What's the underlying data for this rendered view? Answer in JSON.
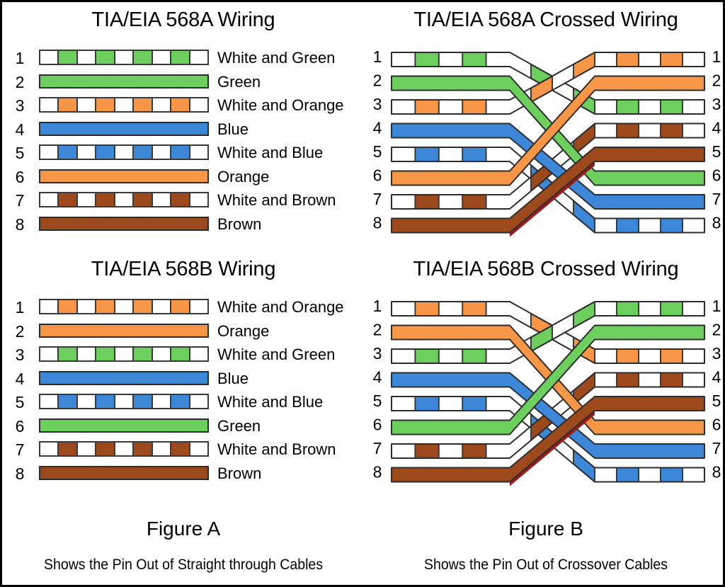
{
  "colors": {
    "green": "#6CCF5E",
    "orange": "#F79646",
    "blue": "#3D87D8",
    "brown": "#9C4A1C",
    "white": "#FFFFFF",
    "dark_red": "#9E1B1B",
    "outline": "#3A3A3A",
    "text": "#000000",
    "background": "#FFFFFF"
  },
  "panels": {
    "a_top": {
      "title": "TIA/EIA 568A Wiring",
      "pins": [
        {
          "num": "1",
          "label": "White and Green",
          "color": "green",
          "striped": true
        },
        {
          "num": "2",
          "label": "Green",
          "color": "green",
          "striped": false
        },
        {
          "num": "3",
          "label": "White and Orange",
          "color": "orange",
          "striped": true
        },
        {
          "num": "4",
          "label": "Blue",
          "color": "blue",
          "striped": false
        },
        {
          "num": "5",
          "label": "White and Blue",
          "color": "blue",
          "striped": true
        },
        {
          "num": "6",
          "label": "Orange",
          "color": "orange",
          "striped": false
        },
        {
          "num": "7",
          "label": "White and Brown",
          "color": "brown",
          "striped": true
        },
        {
          "num": "8",
          "label": "Brown",
          "color": "brown",
          "striped": false
        }
      ]
    },
    "b_bottom": {
      "title": "TIA/EIA 568B Wiring",
      "pins": [
        {
          "num": "1",
          "label": "White and Orange",
          "color": "orange",
          "striped": true
        },
        {
          "num": "2",
          "label": "Orange",
          "color": "orange",
          "striped": false
        },
        {
          "num": "3",
          "label": "White and Green",
          "color": "green",
          "striped": true
        },
        {
          "num": "4",
          "label": "Blue",
          "color": "blue",
          "striped": false
        },
        {
          "num": "5",
          "label": "White and Blue",
          "color": "blue",
          "striped": true
        },
        {
          "num": "6",
          "label": "Green",
          "color": "green",
          "striped": false
        },
        {
          "num": "7",
          "label": "White and Brown",
          "color": "brown",
          "striped": true
        },
        {
          "num": "8",
          "label": "Brown",
          "color": "brown",
          "striped": false
        }
      ]
    },
    "a_crossed": {
      "title": "TIA/EIA 568A Crossed Wiring",
      "left_pins": [
        "1",
        "2",
        "3",
        "4",
        "5",
        "6",
        "7",
        "8"
      ],
      "right_pins": [
        "1",
        "2",
        "3",
        "4",
        "5",
        "6",
        "7",
        "8"
      ],
      "wires": [
        {
          "from": 1,
          "to": 3,
          "color": "green",
          "striped": true
        },
        {
          "from": 2,
          "to": 6,
          "color": "green",
          "striped": false
        },
        {
          "from": 3,
          "to": 1,
          "color": "orange",
          "striped": true
        },
        {
          "from": 4,
          "to": 7,
          "color": "blue",
          "striped": false
        },
        {
          "from": 5,
          "to": 8,
          "color": "blue",
          "striped": true
        },
        {
          "from": 6,
          "to": 2,
          "color": "orange",
          "striped": false
        },
        {
          "from": 7,
          "to": 4,
          "color": "brown",
          "striped": true
        },
        {
          "from": 8,
          "to": 5,
          "color": "brown",
          "striped": false
        }
      ]
    },
    "b_crossed": {
      "title": "TIA/EIA 568B Crossed Wiring",
      "left_pins": [
        "1",
        "2",
        "3",
        "4",
        "5",
        "6",
        "7",
        "8"
      ],
      "right_pins": [
        "1",
        "2",
        "3",
        "4",
        "5",
        "6",
        "7",
        "8"
      ],
      "wires": [
        {
          "from": 1,
          "to": 3,
          "color": "orange",
          "striped": true
        },
        {
          "from": 2,
          "to": 6,
          "color": "orange",
          "striped": false
        },
        {
          "from": 3,
          "to": 1,
          "color": "green",
          "striped": true
        },
        {
          "from": 4,
          "to": 7,
          "color": "blue",
          "striped": false
        },
        {
          "from": 5,
          "to": 8,
          "color": "blue",
          "striped": true
        },
        {
          "from": 6,
          "to": 2,
          "color": "green",
          "striped": false
        },
        {
          "from": 7,
          "to": 4,
          "color": "brown",
          "striped": true
        },
        {
          "from": 8,
          "to": 5,
          "color": "brown",
          "striped": false
        }
      ]
    }
  },
  "captions": {
    "figure_a_title": "Figure A",
    "figure_a_text": "Shows the Pin Out of Straight through Cables",
    "figure_b_title": "Figure B",
    "figure_b_text": "Shows the Pin Out of Crossover Cables"
  }
}
